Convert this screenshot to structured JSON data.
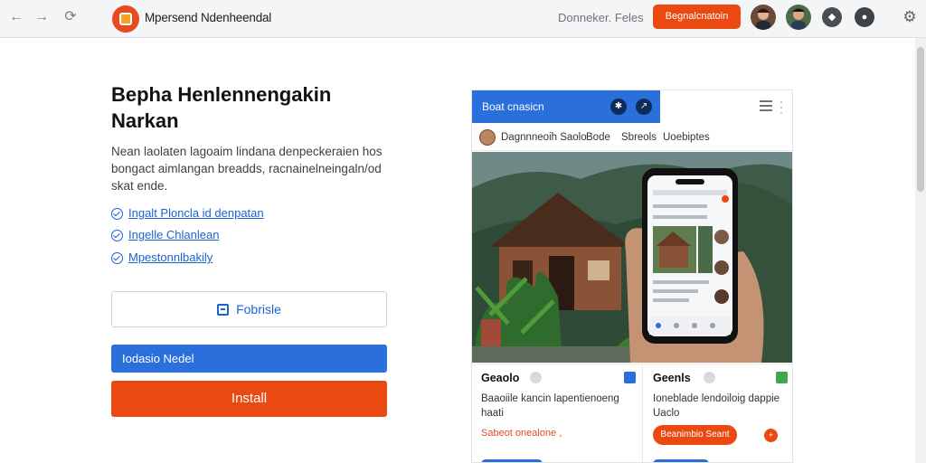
{
  "browser": {
    "back_icon": "←",
    "forward_icon": "→",
    "reload_icon": "⟳"
  },
  "header": {
    "site_title": "Mpersend Ndenheendal",
    "link": "Donneker. Feles",
    "cta": "Begnalcnatoin",
    "more_icon": "◆",
    "bell_icon": "●",
    "gear_icon": "⚙"
  },
  "main": {
    "headline": "Bepha Henlennengakin Narkan",
    "description": "Nean laolaten lagoaim lindana denpeckeraien hos bongact aimlangan breadds, racnainelneingaln/od skat ende.",
    "features": [
      "Ingalt Ploncla id denpatan",
      "Ingelle Chlanlean",
      "Mpestonnlbakily"
    ],
    "outline_button": "Fobrisle",
    "blue_button": "Iodasio Nedel",
    "install_button": "Install"
  },
  "card": {
    "header_title": "Boat cnasicn",
    "subhead": [
      "Dagnnneoih Saolo",
      "Bode",
      "Sbreols",
      "Uoebiptes"
    ],
    "col1": {
      "title": "Geaolo",
      "text": "Baaoiile kancin lapentienoeng haati",
      "link": "Sabeot onealone ,"
    },
    "col2": {
      "title": "Geenls",
      "text": "Ioneblade lendoiloig dappie Uaclo",
      "pill": "Beanimbio Seant",
      "dot": "+"
    }
  },
  "colors": {
    "accent_orange": "#ea4a12",
    "accent_blue": "#2a6fdc",
    "link_blue": "#1a63d4"
  }
}
